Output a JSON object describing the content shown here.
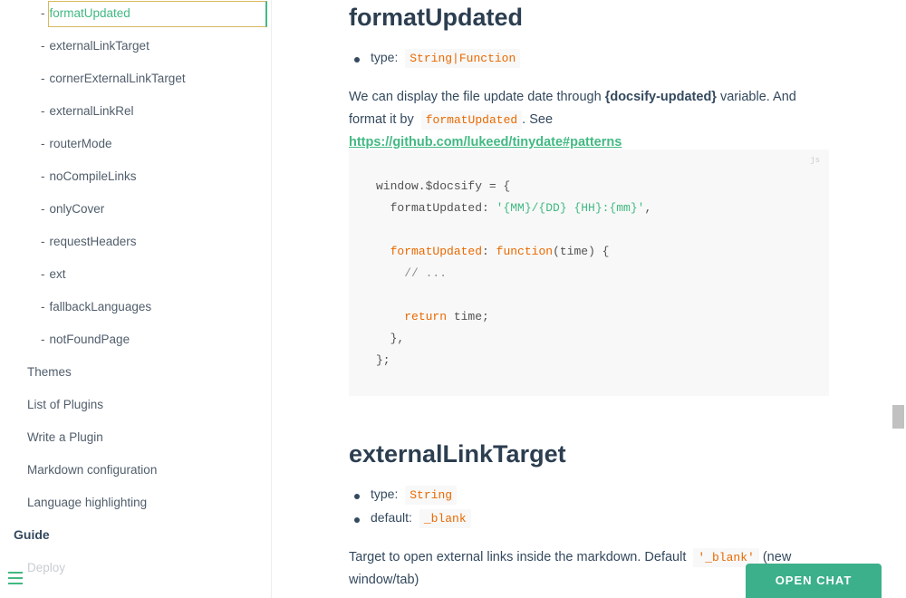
{
  "sidebar": {
    "sub_items": [
      {
        "label": "formatUpdated",
        "active": true
      },
      {
        "label": "externalLinkTarget"
      },
      {
        "label": "cornerExternalLinkTarget"
      },
      {
        "label": "externalLinkRel"
      },
      {
        "label": "routerMode"
      },
      {
        "label": "noCompileLinks"
      },
      {
        "label": "onlyCover"
      },
      {
        "label": "requestHeaders"
      },
      {
        "label": "ext"
      },
      {
        "label": "fallbackLanguages"
      },
      {
        "label": "notFoundPage"
      }
    ],
    "items": [
      {
        "label": "Themes"
      },
      {
        "label": "List of Plugins"
      },
      {
        "label": "Write a Plugin"
      },
      {
        "label": "Markdown configuration"
      },
      {
        "label": "Language highlighting"
      }
    ],
    "section": "Guide",
    "faded_item": "Deploy",
    "dash": "-"
  },
  "content": {
    "heading1": "formatUpdated",
    "type_label": "type:",
    "type1_value": "String|Function",
    "para1_a": "We can display the file update date through ",
    "para1_var": "{docsify-updated}",
    "para1_b": " variable. And format it by ",
    "para1_code": "formatUpdated",
    "para1_c": ". See ",
    "para1_link": "https://github.com/lukeed/tinydate#patterns",
    "code_lang": "js",
    "heading2": "externalLinkTarget",
    "type2_value": "String",
    "default_label": "default:",
    "default2_value": "_blank",
    "para2_a": "Target to open external links inside the markdown. Default ",
    "para2_code": "'_blank'",
    "para2_b": " (new window/tab)"
  },
  "chat": {
    "label": "OPEN CHAT"
  },
  "colors": {
    "accent": "#42b983",
    "text": "#34495e",
    "code": "#e96900",
    "chat": "#3cb08a"
  }
}
